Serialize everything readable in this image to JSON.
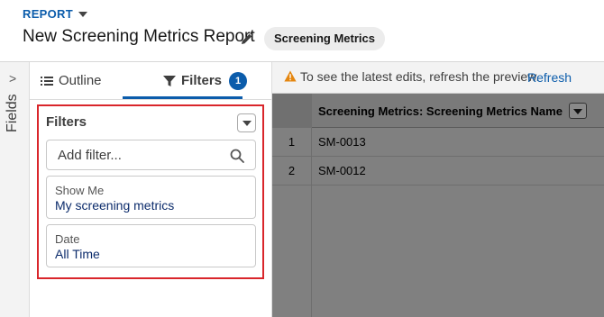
{
  "header": {
    "report_label": "REPORT",
    "title": "New Screening Metrics Report",
    "object_pill": "Screening Metrics"
  },
  "rail": {
    "label": "Fields",
    "chevron": ">"
  },
  "tabs": {
    "outline_label": "Outline",
    "filters_label": "Filters",
    "filters_count": "1"
  },
  "filters": {
    "heading": "Filters",
    "search_placeholder": "Add filter...",
    "cards": [
      {
        "label": "Show Me",
        "value": "My screening metrics"
      },
      {
        "label": "Date",
        "value": "All Time"
      }
    ]
  },
  "preview": {
    "banner_text": "To see the latest edits, refresh the preview.",
    "refresh_label": "Refresh",
    "column_header": "Screening Metrics: Screening Metrics Name",
    "rows": [
      {
        "num": "1",
        "value": "SM-0013"
      },
      {
        "num": "2",
        "value": "SM-0012"
      }
    ]
  },
  "colors": {
    "accent": "#0b5cab",
    "highlight_box": "#d9262b",
    "preview_overlay": "#808080"
  }
}
